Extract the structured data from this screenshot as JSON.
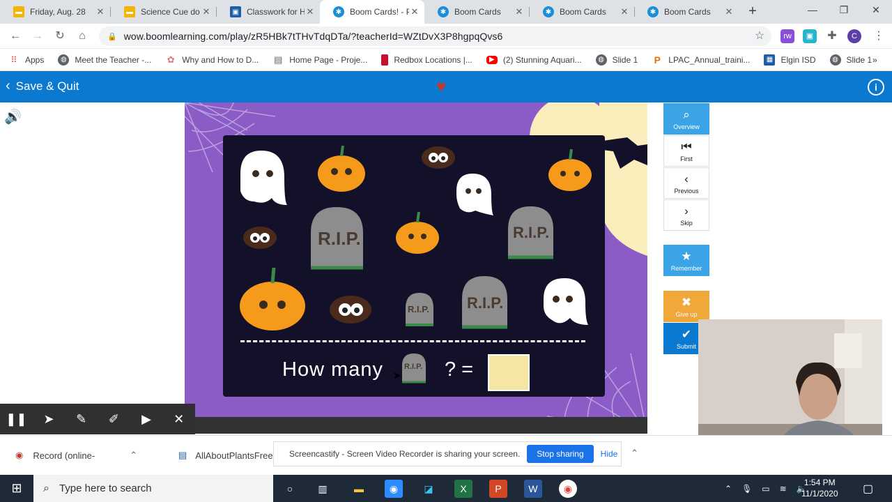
{
  "tabs": [
    {
      "title": "Friday, Aug. 28",
      "icon": "slides-icon",
      "color": "#f4b400",
      "active": false
    },
    {
      "title": "Science Cue do",
      "icon": "slides-icon",
      "color": "#f4b400",
      "active": false
    },
    {
      "title": "Classwork for H",
      "icon": "classroom-icon",
      "color": "#1e5ea8",
      "active": false
    },
    {
      "title": "Boom Cards! - P",
      "icon": "boom-icon",
      "color": "#1a8fd8",
      "active": true
    },
    {
      "title": "Boom Cards",
      "icon": "boom-icon",
      "color": "#1a8fd8",
      "active": false
    },
    {
      "title": "Boom Cards",
      "icon": "boom-icon",
      "color": "#1a8fd8",
      "active": false
    },
    {
      "title": "Boom Cards",
      "icon": "boom-icon",
      "color": "#1a8fd8",
      "active": false
    }
  ],
  "url": "wow.boomlearning.com/play/zR5HBk7tTHvTdqDTa/?teacherId=WZtDvX3P8hgpqQvs6",
  "bookmarks": [
    {
      "label": "Apps",
      "icon": "apps-grid-icon"
    },
    {
      "label": "Meet the Teacher -...",
      "icon": "globe-icon"
    },
    {
      "label": "Why and How to D...",
      "icon": "lotus-icon"
    },
    {
      "label": "Home Page - Proje...",
      "icon": "page-icon"
    },
    {
      "label": "Redbox Locations |...",
      "icon": "redbox-icon"
    },
    {
      "label": "(2) Stunning Aquari...",
      "icon": "youtube-icon"
    },
    {
      "label": "Slide 1",
      "icon": "globe-icon"
    },
    {
      "label": "LPAC_Annual_traini...",
      "icon": "p-icon"
    },
    {
      "label": "Elgin ISD",
      "icon": "school-icon"
    },
    {
      "label": "Slide 1",
      "icon": "globe-icon"
    }
  ],
  "boom": {
    "save_quit": "Save & Quit",
    "question": "How many",
    "question_mark": "? =",
    "rip_label": "R.I.P.",
    "answer_value": ""
  },
  "side_buttons": [
    {
      "label": "Overview",
      "icon": "search-icon",
      "color": "#3ba4e6"
    },
    {
      "label": "First",
      "icon": "first-icon",
      "color": "#ffffff"
    },
    {
      "label": "Previous",
      "icon": "previous-icon",
      "color": "#ffffff"
    },
    {
      "label": "Skip",
      "icon": "skip-icon",
      "color": "#ffffff"
    },
    {
      "label": "Remember",
      "icon": "star-icon",
      "color": "#3ba4e6"
    },
    {
      "label": "Give up",
      "icon": "x-icon",
      "color": "#f0a83a"
    },
    {
      "label": "Submit",
      "icon": "check-icon",
      "color": "#0b79d0"
    }
  ],
  "downloads": [
    {
      "label": "Record (online-",
      "icon": "record-icon"
    },
    {
      "label": "AllAboutPlantsFree",
      "icon": "file-icon"
    }
  ],
  "share": {
    "message": "Screencastify - Screen Video Recorder is sharing your screen.",
    "stop": "Stop sharing",
    "hide": "Hide"
  },
  "taskbar": {
    "search_placeholder": "Type here to search",
    "time": "1:54 PM",
    "date": "11/1/2020"
  }
}
